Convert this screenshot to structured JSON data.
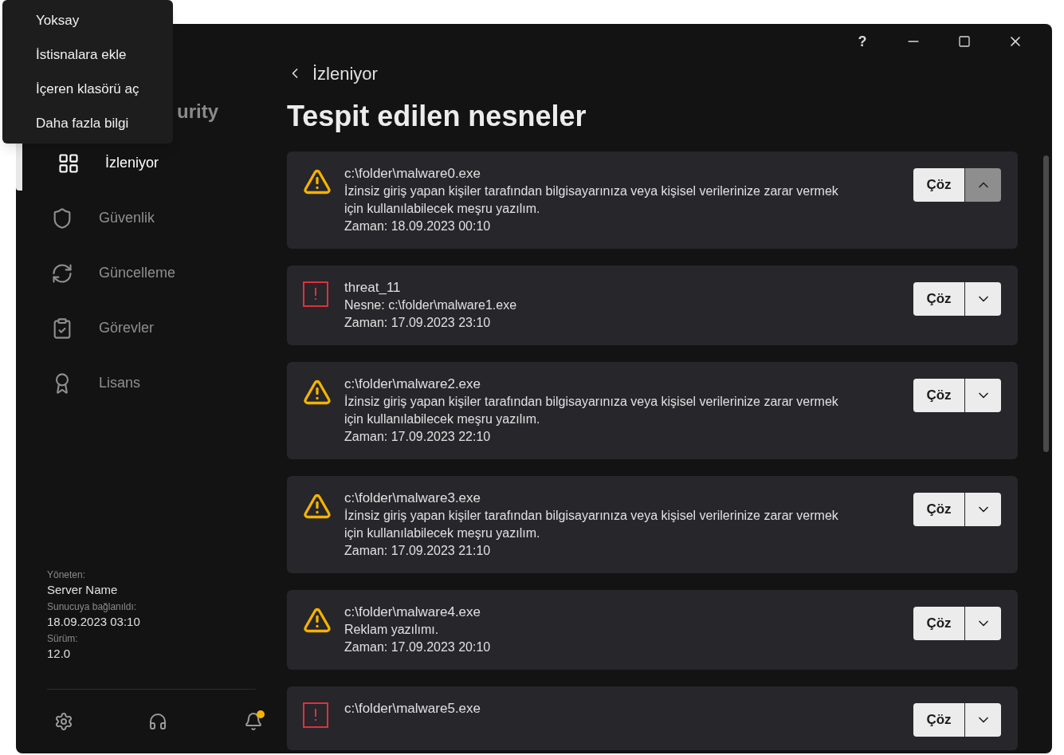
{
  "context_menu": {
    "items": [
      "Yoksay",
      "İstisnalara ekle",
      "İçeren klasörü aç",
      "Daha fazla bilgi"
    ]
  },
  "window": {
    "controls": [
      "?"
    ]
  },
  "sidebar": {
    "app_title": "urity",
    "items": [
      {
        "label": "İzleniyor",
        "selected": true
      },
      {
        "label": "Güvenlik",
        "selected": false
      },
      {
        "label": "Güncelleme",
        "selected": false
      },
      {
        "label": "Görevler",
        "selected": false
      },
      {
        "label": "Lisans",
        "selected": false
      }
    ],
    "info": [
      {
        "label": "Yöneten:",
        "value": "Server Name"
      },
      {
        "label": "Sunucuya bağlanıldı:",
        "value": "18.09.2023 03:10"
      },
      {
        "label": "Sürüm:",
        "value": "12.0"
      }
    ],
    "notification_dot": true
  },
  "back_link": "İzleniyor",
  "title": "Tespit edilen nesneler",
  "detections": [
    {
      "kind": "warning",
      "title": "c:\\folder\\malware0.exe",
      "lines": [
        "İzinsiz giriş yapan kişiler tarafından bilgisayarınıza veya kişisel verilerinize zarar vermek için kullanılabilecek meşru yazılım.",
        "Zaman: 18.09.2023 00:10"
      ],
      "action": "Çöz",
      "expanded": true
    },
    {
      "kind": "threat",
      "title": "threat_11",
      "lines": [
        "Nesne: c:\\folder\\malware1.exe",
        "Zaman: 17.09.2023 23:10"
      ],
      "action": "Çöz",
      "expanded": false
    },
    {
      "kind": "warning",
      "title": "c:\\folder\\malware2.exe",
      "lines": [
        "İzinsiz giriş yapan kişiler tarafından bilgisayarınıza veya kişisel verilerinize zarar vermek için kullanılabilecek meşru yazılım.",
        "Zaman: 17.09.2023 22:10"
      ],
      "action": "Çöz",
      "expanded": false
    },
    {
      "kind": "warning",
      "title": "c:\\folder\\malware3.exe",
      "lines": [
        "İzinsiz giriş yapan kişiler tarafından bilgisayarınıza veya kişisel verilerinize zarar vermek için kullanılabilecek meşru yazılım.",
        "Zaman: 17.09.2023 21:10"
      ],
      "action": "Çöz",
      "expanded": false
    },
    {
      "kind": "warning",
      "title": "c:\\folder\\malware4.exe",
      "lines": [
        "Reklam yazılımı.",
        "Zaman: 17.09.2023 20:10"
      ],
      "action": "Çöz",
      "expanded": false
    },
    {
      "kind": "threat",
      "title": "c:\\folder\\malware5.exe",
      "action": "Çöz",
      "expanded": false
    }
  ]
}
